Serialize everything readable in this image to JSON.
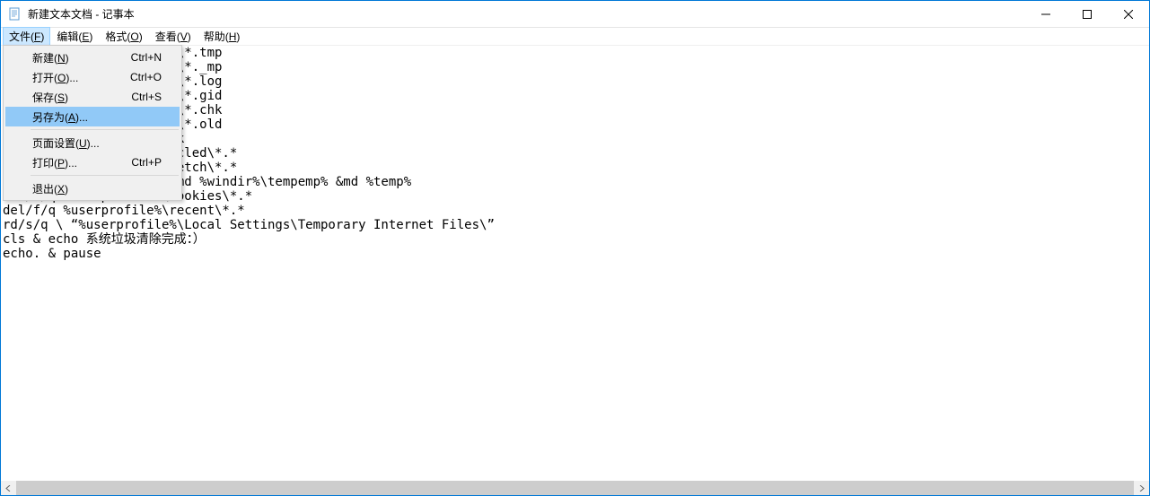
{
  "window": {
    "title": "新建文本文档 - 记事本"
  },
  "menubar": {
    "items": [
      {
        "label": "文件",
        "accel": "F"
      },
      {
        "label": "编辑",
        "accel": "E"
      },
      {
        "label": "格式",
        "accel": "O"
      },
      {
        "label": "查看",
        "accel": "V"
      },
      {
        "label": "帮助",
        "accel": "H"
      }
    ]
  },
  "file_menu": {
    "items": [
      {
        "label": "新建",
        "accel": "N",
        "shortcut": "Ctrl+N"
      },
      {
        "label": "打开",
        "accel": "O",
        "suffix": "...",
        "shortcut": "Ctrl+O"
      },
      {
        "label": "保存",
        "accel": "S",
        "shortcut": "Ctrl+S"
      },
      {
        "label": "另存为",
        "accel": "A",
        "suffix": "...",
        "shortcut": "",
        "highlighted": true
      },
      {
        "sep": true
      },
      {
        "label": "页面设置",
        "accel": "U",
        "suffix": "...",
        "shortcut": ""
      },
      {
        "label": "打印",
        "accel": "P",
        "suffix": "...",
        "shortcut": "Ctrl+P"
      },
      {
        "sep": true
      },
      {
        "label": "退出",
        "accel": "X",
        "shortcut": ""
      }
    ]
  },
  "editor": {
    "text": "del/f/s/q %systemdrive%\\*.tmp\ndel/f/s/q %systemdrive%\\*._mp\ndel/f/s/q %systemdrive%\\*.log\ndel/f/s/q %systemdrive%\\*.gid\ndel/f/s/q %systemdrive%\\*.chk\ndel/f/s/q %systemdrive%\\*.old\ndel/f/s/q %windir%\\*.bak\ndel/f/s/q %windir%\\recycled\\*.*\ndel/f/s/q %windir%\\prefetch\\*.*\nrd/s/q %windir%\\temp & md %windir%\\tempemp% &md %temp%\ndel/f/q %userprofile%\\cookies\\*.*\ndel/f/q %userprofile%\\recent\\*.*\nrd/s/q \\ “%userprofile%\\Local Settings\\Temporary Internet Files\\”\ncls & echo 系统垃圾清除完成：）\necho. & pause"
  }
}
